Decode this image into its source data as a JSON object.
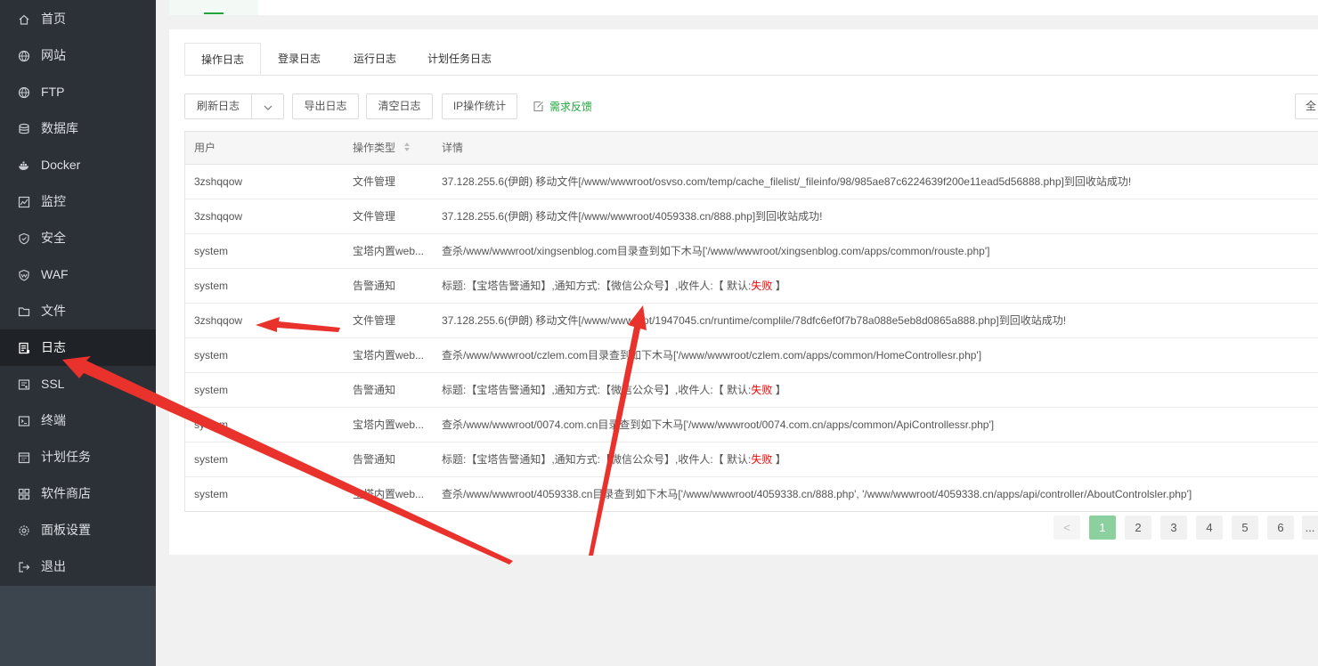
{
  "sidebar": {
    "items": [
      {
        "label": "首页",
        "icon": "home-icon"
      },
      {
        "label": "网站",
        "icon": "globe-icon"
      },
      {
        "label": "FTP",
        "icon": "globe-icon"
      },
      {
        "label": "数据库",
        "icon": "database-icon"
      },
      {
        "label": "Docker",
        "icon": "docker-icon"
      },
      {
        "label": "监控",
        "icon": "monitor-icon"
      },
      {
        "label": "安全",
        "icon": "shield-icon"
      },
      {
        "label": "WAF",
        "icon": "waf-shield-icon"
      },
      {
        "label": "文件",
        "icon": "folder-icon"
      },
      {
        "label": "日志",
        "icon": "log-icon"
      },
      {
        "label": "SSL",
        "icon": "ssl-icon"
      },
      {
        "label": "终端",
        "icon": "terminal-icon"
      },
      {
        "label": "计划任务",
        "icon": "calendar-icon"
      },
      {
        "label": "软件商店",
        "icon": "apps-icon"
      },
      {
        "label": "面板设置",
        "icon": "gear-icon"
      },
      {
        "label": "退出",
        "icon": "logout-icon"
      }
    ],
    "active_index": 9
  },
  "tabs": [
    "操作日志",
    "登录日志",
    "运行日志",
    "计划任务日志"
  ],
  "toolbar": {
    "refresh": "刷新日志",
    "export": "导出日志",
    "clear": "清空日志",
    "ip_stats": "IP操作统计",
    "feedback": "需求反馈",
    "right_cut": "全"
  },
  "table": {
    "headers": {
      "user": "用户",
      "type": "操作类型",
      "detail": "详情"
    },
    "rows": [
      {
        "user": "3zshqqow",
        "type": "文件管理",
        "detail": "37.128.255.6(伊朗) 移动文件[/www/wwwroot/osvso.com/temp/cache_filelist/_fileinfo/98/985ae87c6224639f200e11ead5d56888.php]到回收站成功!"
      },
      {
        "user": "3zshqqow",
        "type": "文件管理",
        "detail": "37.128.255.6(伊朗) 移动文件[/www/wwwroot/4059338.cn/888.php]到回收站成功!"
      },
      {
        "user": "system",
        "type": "宝塔内置web...",
        "detail": "查杀/www/wwwroot/xingsenblog.com目录查到如下木马['/www/wwwroot/xingsenblog.com/apps/common/rouste.php']"
      },
      {
        "user": "system",
        "type": "告警通知",
        "detail": "标题:【宝塔告警通知】,通知方式:【微信公众号】,收件人:【 默认:",
        "fail": "失败",
        "tail": " 】"
      },
      {
        "user": "3zshqqow",
        "type": "文件管理",
        "detail": "37.128.255.6(伊朗) 移动文件[/www/wwwroot/1947045.cn/runtime/complile/78dfc6ef0f7b78a088e5eb8d0865a888.php]到回收站成功!"
      },
      {
        "user": "system",
        "type": "宝塔内置web...",
        "detail": "查杀/www/wwwroot/czlem.com目录查到如下木马['/www/wwwroot/czlem.com/apps/common/HomeControllesr.php']"
      },
      {
        "user": "system",
        "type": "告警通知",
        "detail": "标题:【宝塔告警通知】,通知方式:【微信公众号】,收件人:【 默认:",
        "fail": "失败",
        "tail": " 】"
      },
      {
        "user": "system",
        "type": "宝塔内置web...",
        "detail": "查杀/www/wwwroot/0074.com.cn目录查到如下木马['/www/wwwroot/0074.com.cn/apps/common/ApiControllessr.php']"
      },
      {
        "user": "system",
        "type": "告警通知",
        "detail": "标题:【宝塔告警通知】,通知方式:【微信公众号】,收件人:【 默认:",
        "fail": "失败",
        "tail": " 】"
      },
      {
        "user": "system",
        "type": "宝塔内置web...",
        "detail": "查杀/www/wwwroot/4059338.cn目录查到如下木马['/www/wwwroot/4059338.cn/888.php', '/www/wwwroot/4059338.cn/apps/api/controller/AboutControlsler.php']"
      }
    ]
  },
  "pagination": {
    "prev": "<",
    "pages": [
      "1",
      "2",
      "3",
      "4",
      "5",
      "6"
    ],
    "more": "...",
    "current": "1"
  },
  "colors": {
    "accent": "#20a53a",
    "fail": "#ef0808",
    "annotation_arrow": "#e8322b",
    "sidebar_bg": "#2b3137"
  }
}
